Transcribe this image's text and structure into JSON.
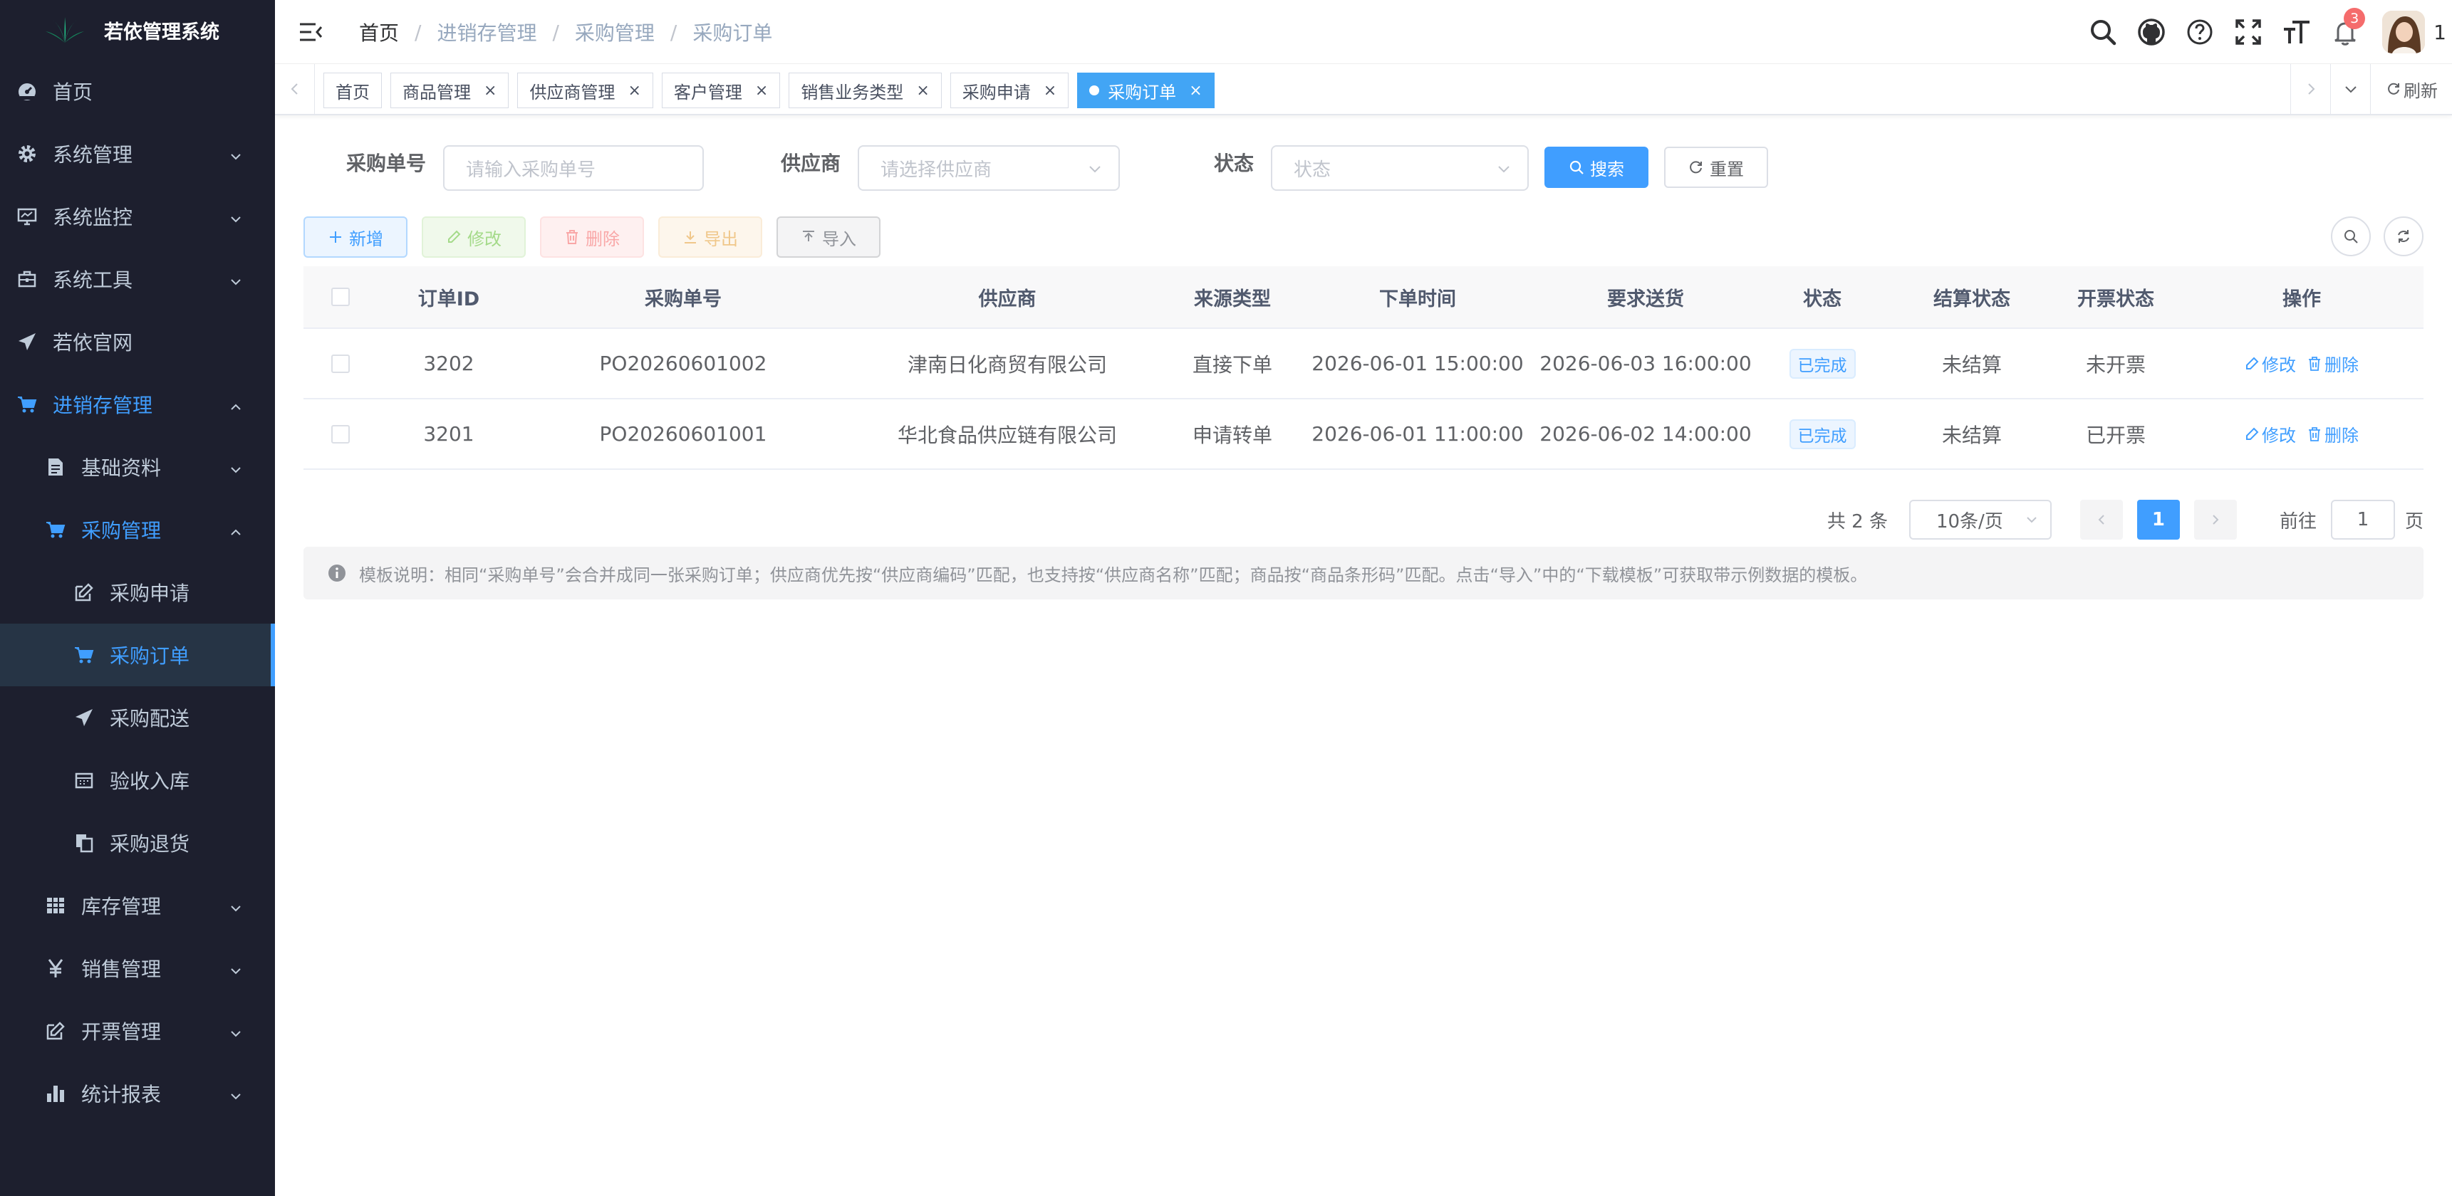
{
  "app": {
    "title": "若依管理系统"
  },
  "sidebar": {
    "items": [
      {
        "label": "首页",
        "icon": "dashboard-icon"
      },
      {
        "label": "系统管理",
        "icon": "gear-icon"
      },
      {
        "label": "系统监控",
        "icon": "monitor-icon"
      },
      {
        "label": "系统工具",
        "icon": "toolbox-icon"
      },
      {
        "label": "若依官网",
        "icon": "paper-plane-icon"
      },
      {
        "label": "进销存管理",
        "icon": "shopping-cart-icon"
      },
      {
        "label": "基础资料",
        "icon": "document-icon"
      },
      {
        "label": "采购管理",
        "icon": "shopping-cart-icon"
      },
      {
        "label": "采购申请",
        "icon": "edit-icon"
      },
      {
        "label": "采购订单",
        "icon": "shopping-cart-icon"
      },
      {
        "label": "采购配送",
        "icon": "paper-plane-icon"
      },
      {
        "label": "验收入库",
        "icon": "calendar-icon"
      },
      {
        "label": "采购退货",
        "icon": "copy-icon"
      },
      {
        "label": "库存管理",
        "icon": "table-icon"
      },
      {
        "label": "销售管理",
        "icon": "yen-icon"
      },
      {
        "label": "开票管理",
        "icon": "edit-icon"
      },
      {
        "label": "统计报表",
        "icon": "bar-chart-icon"
      }
    ]
  },
  "navbar": {
    "breadcrumb": [
      "首页",
      "进销存管理",
      "采购管理",
      "采购订单"
    ],
    "notification_count": "3",
    "avatar_text": "1"
  },
  "tags_view": {
    "tags": [
      "首页",
      "商品管理",
      "供应商管理",
      "客户管理",
      "销售业务类型",
      "采购申请",
      "采购订单"
    ],
    "refresh_label": "刷新"
  },
  "search": {
    "order_no_label": "采购单号",
    "order_no_placeholder": "请输入采购单号",
    "supplier_label": "供应商",
    "supplier_placeholder": "请选择供应商",
    "status_label": "状态",
    "status_placeholder": "状态",
    "search_button": "搜索",
    "reset_button": "重置"
  },
  "toolbar": {
    "add": "新增",
    "edit": "修改",
    "delete": "删除",
    "export": "导出",
    "import": "导入"
  },
  "table": {
    "columns": [
      "订单ID",
      "采购单号",
      "供应商",
      "来源类型",
      "下单时间",
      "要求送货",
      "状态",
      "结算状态",
      "开票状态",
      "操作"
    ],
    "rows": [
      {
        "id": "3202",
        "order_no": "PO20260601002",
        "supplier": "津南日化商贸有限公司",
        "source": "直接下单",
        "order_time": "2026-06-01 15:00:00",
        "delivery": "2026-06-03 16:00:00",
        "status": "已完成",
        "settlement": "未结算",
        "invoice": "未开票",
        "edit": "修改",
        "delete": "删除"
      },
      {
        "id": "3201",
        "order_no": "PO20260601001",
        "supplier": "华北食品供应链有限公司",
        "source": "申请转单",
        "order_time": "2026-06-01 11:00:00",
        "delivery": "2026-06-02 14:00:00",
        "status": "已完成",
        "settlement": "未结算",
        "invoice": "已开票",
        "edit": "修改",
        "delete": "删除"
      }
    ]
  },
  "pagination": {
    "total": "共 2 条",
    "page_size": "10条/页",
    "current_page": "1",
    "goto_label": "前往",
    "goto_value": "1",
    "page_suffix": "页"
  },
  "info": {
    "text": "模板说明：相同“采购单号”会合并成同一张采购订单；供应商优先按“供应商编码”匹配，也支持按“供应商名称”匹配；商品按“商品条形码”匹配。点击“导入”中的“下载模板”可获取带示例数据的模板。"
  },
  "colors": {
    "sidebar_bg": "#1d1f2e",
    "accent": "#409eff",
    "active_tag": "#42a5f5",
    "badge": "#f56c6c"
  }
}
